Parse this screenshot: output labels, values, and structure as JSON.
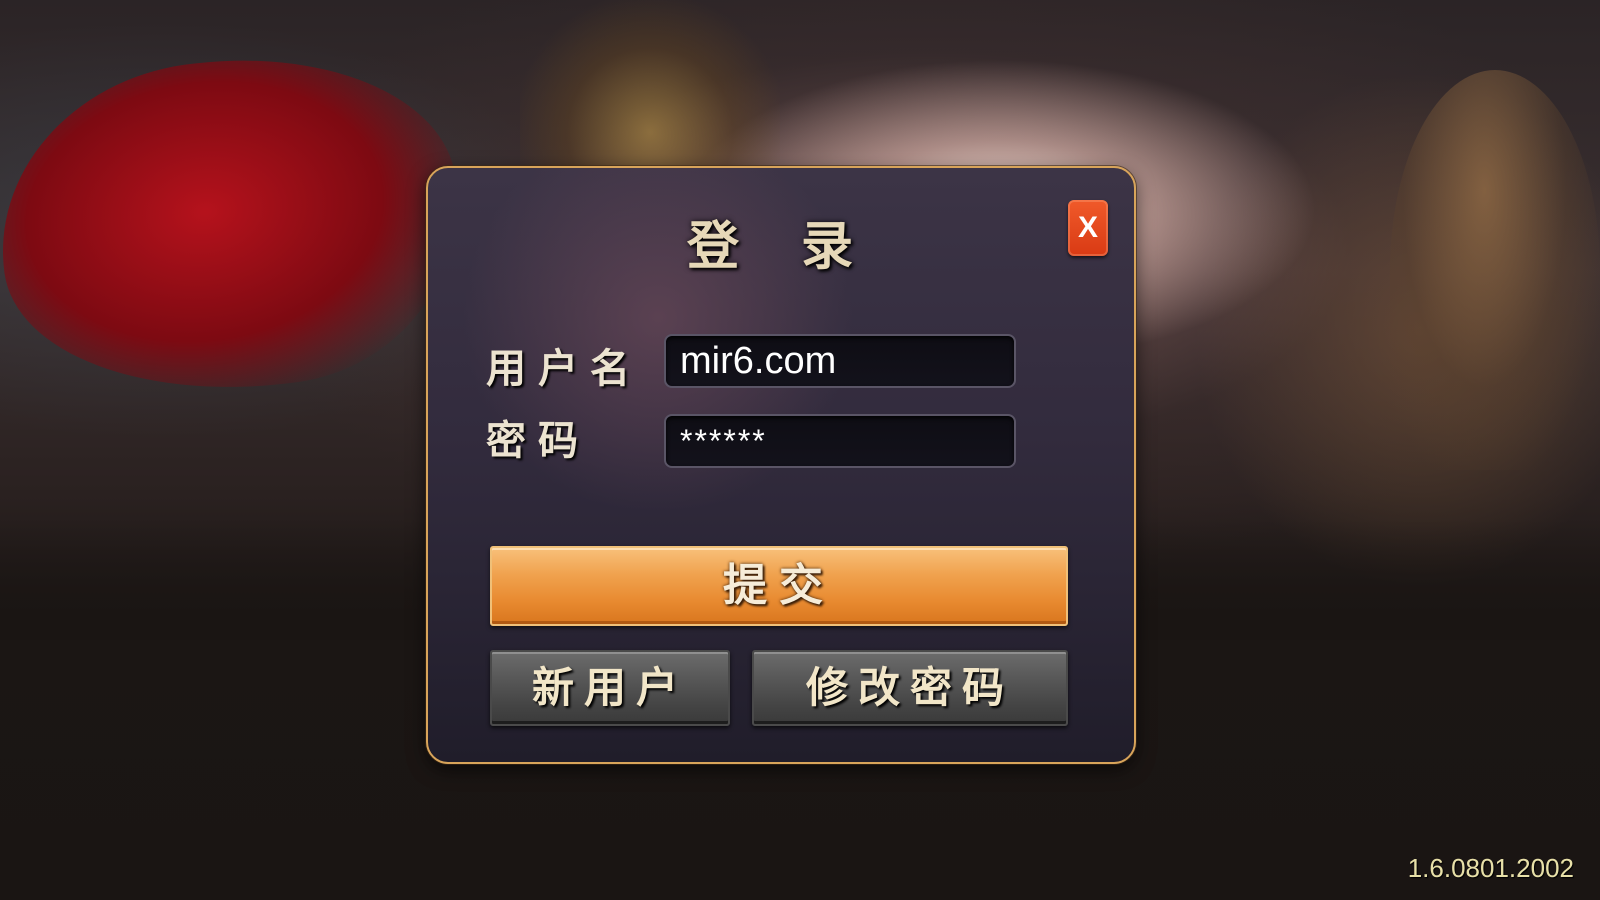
{
  "dialog": {
    "title": "登 录",
    "close_label": "X",
    "username_label": "用户名",
    "username_value": "mir6.com",
    "password_label": "密码",
    "password_value": "******",
    "submit_label": "提交",
    "new_user_label": "新用户",
    "change_password_label": "修改密码"
  },
  "footer": {
    "version": "1.6.0801.2002"
  },
  "colors": {
    "dialog_border": "#d8a45a",
    "submit_button": "#f0a24e",
    "close_button": "#e8481e",
    "secondary_button": "#565656",
    "version_text": "#e8e0a8"
  },
  "icons": {
    "close": "close-icon"
  }
}
